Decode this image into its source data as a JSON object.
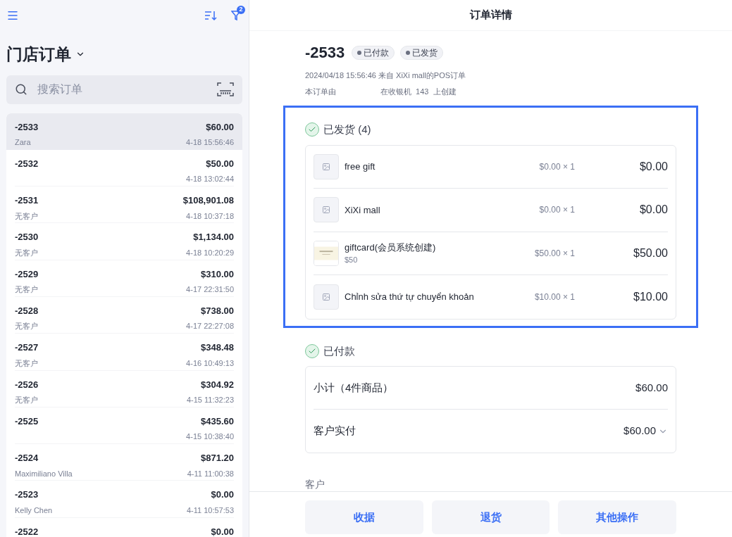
{
  "sidebar": {
    "filter_badge": "2",
    "title": "门店订单",
    "search": {
      "placeholder": "搜索订单"
    },
    "orders": [
      {
        "number": "-2533",
        "total": "$60.00",
        "customer": "Zara",
        "time": "4-18 15:56:46",
        "selected": true
      },
      {
        "number": "-2532",
        "total": "$50.00",
        "time": "4-18 13:02:44",
        "selected": false
      },
      {
        "number": "-2531",
        "total": "$108,901.08",
        "customer": "无客户",
        "time": "4-18 10:37:18",
        "selected": false
      },
      {
        "number": "-2530",
        "total": "$1,134.00",
        "customer": "无客户",
        "time": "4-18 10:20:29",
        "selected": false
      },
      {
        "number": "-2529",
        "total": "$310.00",
        "customer": "无客户",
        "time": "4-17 22:31:50",
        "selected": false
      },
      {
        "number": "-2528",
        "total": "$738.00",
        "customer": "无客户",
        "time": "4-17 22:27:08",
        "selected": false
      },
      {
        "number": "-2527",
        "total": "$348.48",
        "customer": "无客户",
        "time": "4-16 10:49:13",
        "selected": false
      },
      {
        "number": "-2526",
        "total": "$304.92",
        "customer": "无客户",
        "time": "4-15 11:32:23",
        "selected": false
      },
      {
        "number": "-2525",
        "total": "$435.60",
        "time": "4-15 10:38:40",
        "selected": false
      },
      {
        "number": "-2524",
        "total": "$871.20",
        "customer": "Maximiliano Villa",
        "time": "4-11 11:00:38",
        "selected": false
      },
      {
        "number": "-2523",
        "total": "$0.00",
        "customer": "Kelly Chen",
        "time": "4-11 10:57:53",
        "selected": false
      },
      {
        "number": "-2522",
        "total": "$0.00",
        "selected": false
      }
    ]
  },
  "detail": {
    "title": "订单详情",
    "number": "-2533",
    "badges": [
      "已付款",
      "已发货"
    ],
    "meta": "2024/04/18 15:56:46 来自 XiXi mall的POS订单",
    "created_prefix": "本订单由",
    "created_suffix": "在收银机  143  上创建",
    "shipped": {
      "title": "已发货 (4)",
      "items": [
        {
          "kind": "placeholder",
          "name": "free gift",
          "unit": "$0.00 × 1",
          "total": "$0.00"
        },
        {
          "kind": "placeholder",
          "name": "XiXi mall",
          "unit": "$0.00 × 1",
          "total": "$0.00"
        },
        {
          "kind": "picture",
          "name": "giftcard(会员系统创建)",
          "variant": "$50",
          "unit": "$50.00 × 1",
          "total": "$50.00"
        },
        {
          "kind": "placeholder",
          "name": "Chỉnh sửa thứ tự chuyển khoản",
          "unit": "$10.00 × 1",
          "total": "$10.00"
        }
      ]
    },
    "paid": {
      "title": "已付款",
      "rows": [
        {
          "kind": "plain",
          "label": "小计（4件商品）",
          "value": "$60.00"
        },
        {
          "kind": "dropdown",
          "label": "客户实付",
          "value": "$60.00"
        }
      ]
    },
    "customer_heading": "客户",
    "actions": [
      "收据",
      "退货",
      "其他操作"
    ]
  }
}
